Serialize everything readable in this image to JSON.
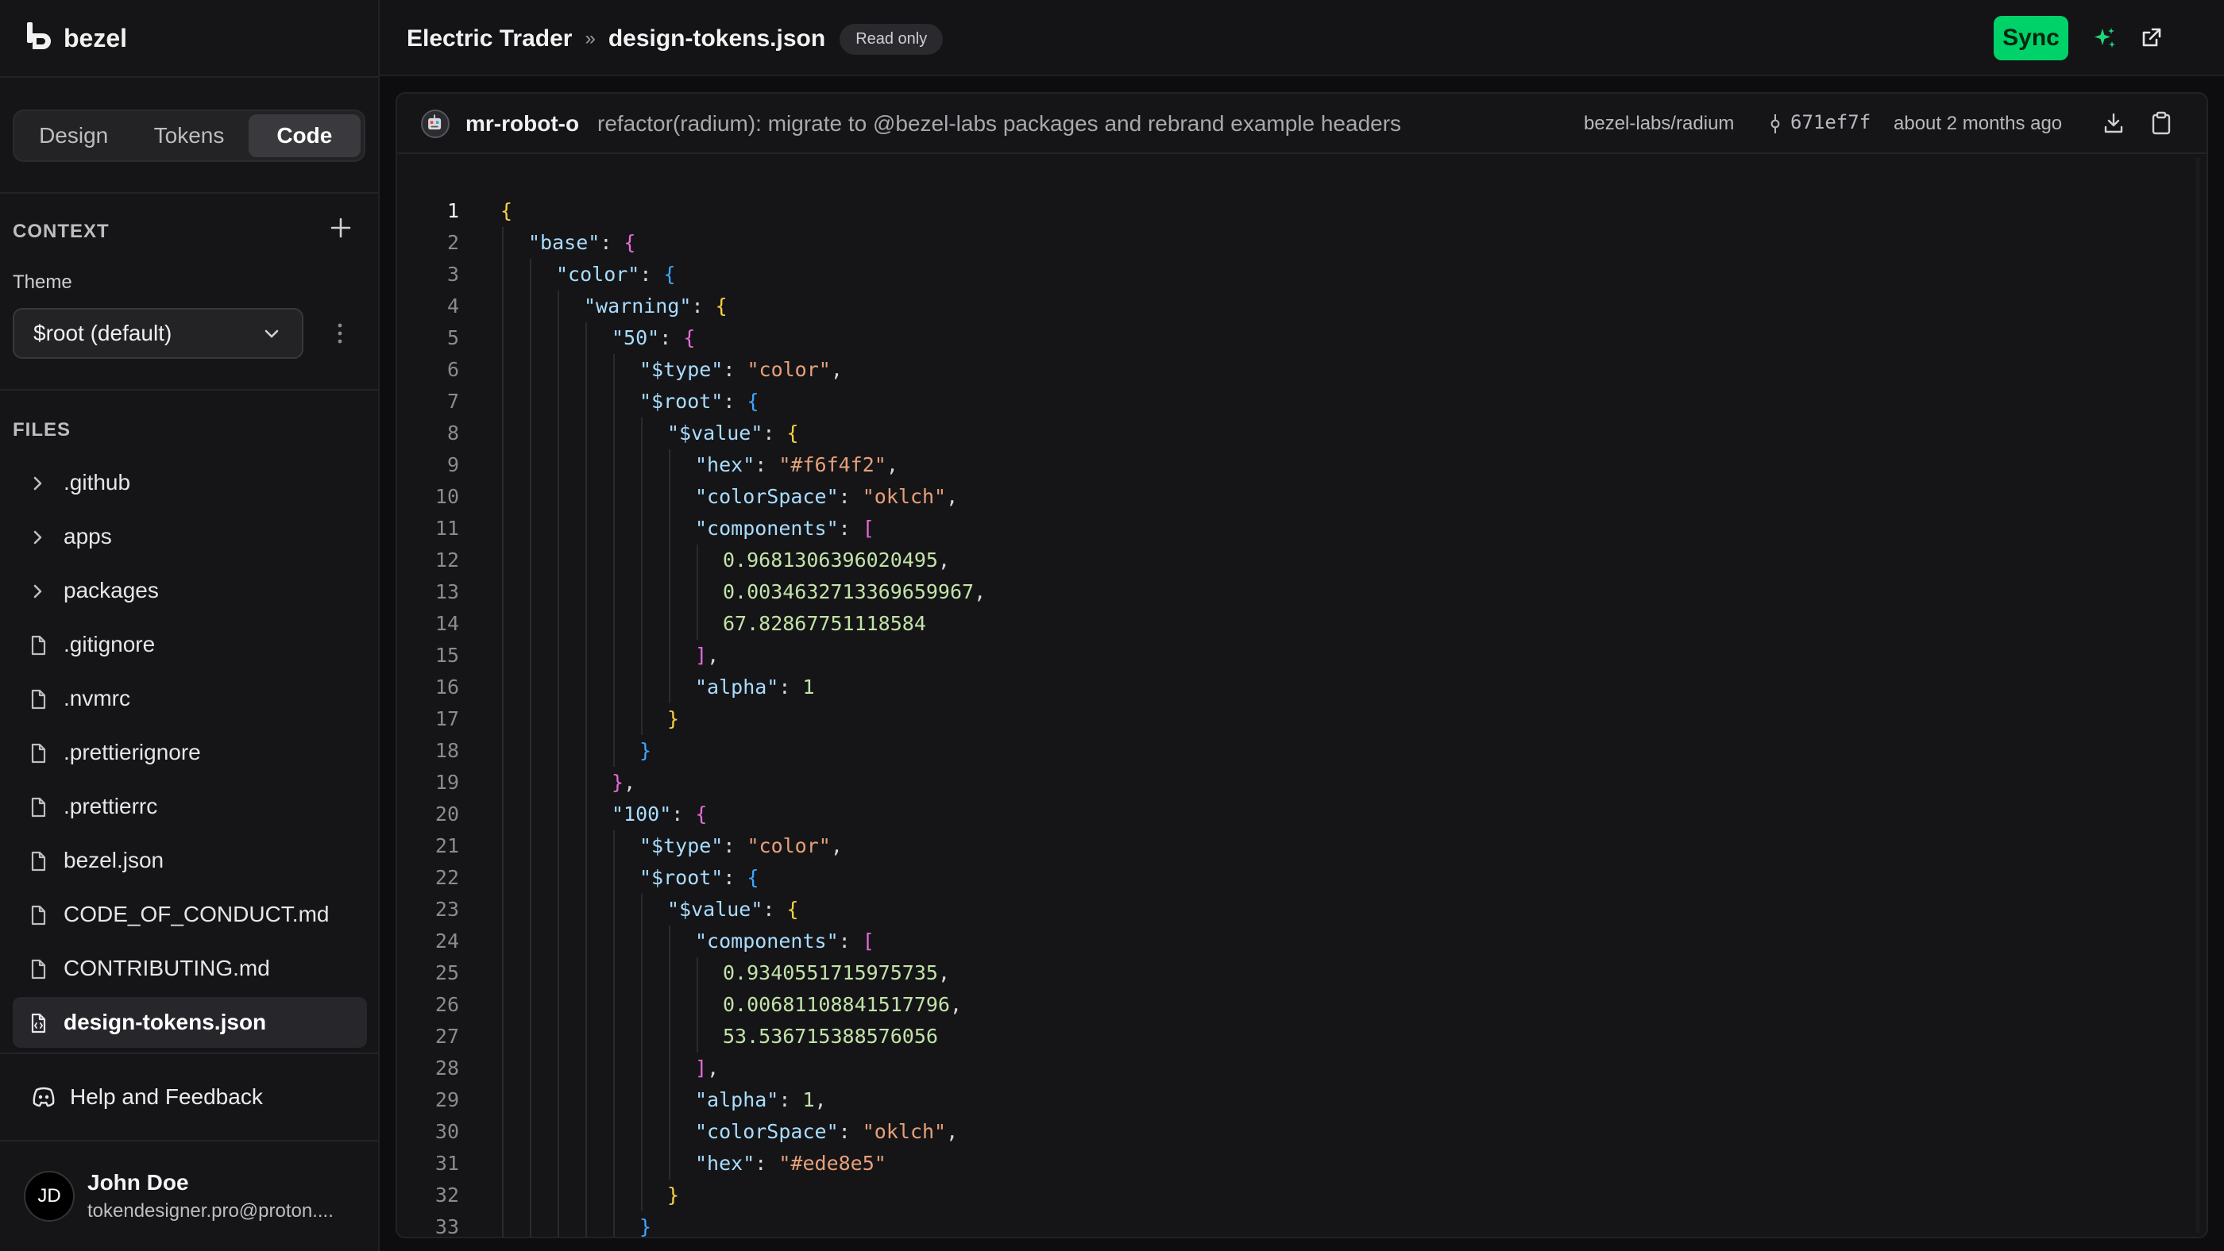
{
  "app": {
    "name": "bezel"
  },
  "sidebar": {
    "tabs": [
      {
        "label": "Design",
        "active": false
      },
      {
        "label": "Tokens",
        "active": false
      },
      {
        "label": "Code",
        "active": true
      }
    ],
    "context_heading": "CONTEXT",
    "theme_label": "Theme",
    "theme_value": "$root (default)",
    "files_heading": "FILES",
    "files": [
      {
        "name": ".github",
        "type": "folder"
      },
      {
        "name": "apps",
        "type": "folder"
      },
      {
        "name": "packages",
        "type": "folder"
      },
      {
        "name": ".gitignore",
        "type": "file"
      },
      {
        "name": ".nvmrc",
        "type": "file"
      },
      {
        "name": ".prettierignore",
        "type": "file"
      },
      {
        "name": ".prettierrc",
        "type": "file"
      },
      {
        "name": "bezel.json",
        "type": "file"
      },
      {
        "name": "CODE_OF_CONDUCT.md",
        "type": "file"
      },
      {
        "name": "CONTRIBUTING.md",
        "type": "file"
      },
      {
        "name": "design-tokens.json",
        "type": "json-file",
        "active": true
      }
    ],
    "help_label": "Help and Feedback",
    "user": {
      "initials": "JD",
      "name": "John Doe",
      "email": "tokendesigner.pro@proton...."
    }
  },
  "header": {
    "project": "Electric Trader",
    "separator": "»",
    "file": "design-tokens.json",
    "badge": "Read only",
    "sync_label": "Sync"
  },
  "commit": {
    "author": "mr-robot-o",
    "message": "refactor(radium): migrate to @bezel-labs packages and rebrand example headers",
    "repo": "bezel-labs/radium",
    "hash": "671ef7f",
    "time": "about 2 months ago"
  },
  "colors": {
    "accent": "#00d26a",
    "bg": "#0d0d0f",
    "panel": "#151517"
  },
  "code": {
    "current_line": 1,
    "lines": [
      [
        0,
        [
          [
            "{",
            "b1"
          ]
        ]
      ],
      [
        1,
        [
          [
            "\"base\"",
            "t-key"
          ],
          [
            ": ",
            "t-pun"
          ],
          [
            "{",
            "b2"
          ]
        ]
      ],
      [
        2,
        [
          [
            "\"color\"",
            "t-key"
          ],
          [
            ": ",
            "t-pun"
          ],
          [
            "{",
            "b3"
          ]
        ]
      ],
      [
        3,
        [
          [
            "\"warning\"",
            "t-key"
          ],
          [
            ": ",
            "t-pun"
          ],
          [
            "{",
            "b1"
          ]
        ]
      ],
      [
        4,
        [
          [
            "\"50\"",
            "t-key"
          ],
          [
            ": ",
            "t-pun"
          ],
          [
            "{",
            "b2"
          ]
        ]
      ],
      [
        5,
        [
          [
            "\"$type\"",
            "t-key"
          ],
          [
            ": ",
            "t-pun"
          ],
          [
            "\"color\"",
            "t-str"
          ],
          [
            ",",
            "t-pun"
          ]
        ]
      ],
      [
        5,
        [
          [
            "\"$root\"",
            "t-key"
          ],
          [
            ": ",
            "t-pun"
          ],
          [
            "{",
            "b3"
          ]
        ]
      ],
      [
        6,
        [
          [
            "\"$value\"",
            "t-key"
          ],
          [
            ": ",
            "t-pun"
          ],
          [
            "{",
            "b1"
          ]
        ]
      ],
      [
        7,
        [
          [
            "\"hex\"",
            "t-key"
          ],
          [
            ": ",
            "t-pun"
          ],
          [
            "\"#f6f4f2\"",
            "t-str"
          ],
          [
            ",",
            "t-pun"
          ]
        ]
      ],
      [
        7,
        [
          [
            "\"colorSpace\"",
            "t-key"
          ],
          [
            ": ",
            "t-pun"
          ],
          [
            "\"oklch\"",
            "t-str"
          ],
          [
            ",",
            "t-pun"
          ]
        ]
      ],
      [
        7,
        [
          [
            "\"components\"",
            "t-key"
          ],
          [
            ": ",
            "t-pun"
          ],
          [
            "[",
            "b2"
          ]
        ]
      ],
      [
        8,
        [
          [
            "0.9681306396020495",
            "t-num"
          ],
          [
            ",",
            "t-pun"
          ]
        ]
      ],
      [
        8,
        [
          [
            "0.0034632713369659967",
            "t-num"
          ],
          [
            ",",
            "t-pun"
          ]
        ]
      ],
      [
        8,
        [
          [
            "67.82867751118584",
            "t-num"
          ]
        ]
      ],
      [
        7,
        [
          [
            "]",
            "b2"
          ],
          [
            ",",
            "t-pun"
          ]
        ]
      ],
      [
        7,
        [
          [
            "\"alpha\"",
            "t-key"
          ],
          [
            ": ",
            "t-pun"
          ],
          [
            "1",
            "t-num"
          ]
        ]
      ],
      [
        6,
        [
          [
            "}",
            "b1"
          ]
        ]
      ],
      [
        5,
        [
          [
            "}",
            "b3"
          ]
        ]
      ],
      [
        4,
        [
          [
            "}",
            "b2"
          ],
          [
            ",",
            "t-pun"
          ]
        ]
      ],
      [
        4,
        [
          [
            "\"100\"",
            "t-key"
          ],
          [
            ": ",
            "t-pun"
          ],
          [
            "{",
            "b2"
          ]
        ]
      ],
      [
        5,
        [
          [
            "\"$type\"",
            "t-key"
          ],
          [
            ": ",
            "t-pun"
          ],
          [
            "\"color\"",
            "t-str"
          ],
          [
            ",",
            "t-pun"
          ]
        ]
      ],
      [
        5,
        [
          [
            "\"$root\"",
            "t-key"
          ],
          [
            ": ",
            "t-pun"
          ],
          [
            "{",
            "b3"
          ]
        ]
      ],
      [
        6,
        [
          [
            "\"$value\"",
            "t-key"
          ],
          [
            ": ",
            "t-pun"
          ],
          [
            "{",
            "b1"
          ]
        ]
      ],
      [
        7,
        [
          [
            "\"components\"",
            "t-key"
          ],
          [
            ": ",
            "t-pun"
          ],
          [
            "[",
            "b2"
          ]
        ]
      ],
      [
        8,
        [
          [
            "0.9340551715975735",
            "t-num"
          ],
          [
            ",",
            "t-pun"
          ]
        ]
      ],
      [
        8,
        [
          [
            "0.00681108841517796",
            "t-num"
          ],
          [
            ",",
            "t-pun"
          ]
        ]
      ],
      [
        8,
        [
          [
            "53.536715388576056",
            "t-num"
          ]
        ]
      ],
      [
        7,
        [
          [
            "]",
            "b2"
          ],
          [
            ",",
            "t-pun"
          ]
        ]
      ],
      [
        7,
        [
          [
            "\"alpha\"",
            "t-key"
          ],
          [
            ": ",
            "t-pun"
          ],
          [
            "1",
            "t-num"
          ],
          [
            ",",
            "t-pun"
          ]
        ]
      ],
      [
        7,
        [
          [
            "\"colorSpace\"",
            "t-key"
          ],
          [
            ": ",
            "t-pun"
          ],
          [
            "\"oklch\"",
            "t-str"
          ],
          [
            ",",
            "t-pun"
          ]
        ]
      ],
      [
        7,
        [
          [
            "\"hex\"",
            "t-key"
          ],
          [
            ": ",
            "t-pun"
          ],
          [
            "\"#ede8e5\"",
            "t-str"
          ]
        ]
      ],
      [
        6,
        [
          [
            "}",
            "b1"
          ]
        ]
      ],
      [
        5,
        [
          [
            "}",
            "b3"
          ]
        ]
      ]
    ]
  }
}
